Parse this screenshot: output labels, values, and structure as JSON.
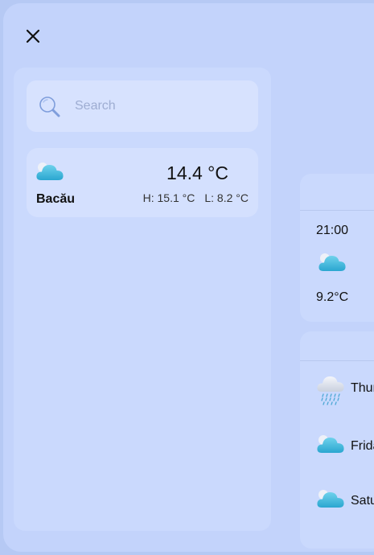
{
  "close": {
    "icon": "close-icon"
  },
  "search": {
    "placeholder": "Search",
    "value": "",
    "icon": "search-icon"
  },
  "city": {
    "name": "Bacău",
    "temperature": "14.4 °C",
    "high": "H: 15.1 °C",
    "low": "L: 8.2 °C",
    "icon": "partly-cloudy-icon"
  },
  "hourly": [
    {
      "time": "21:00",
      "temp": "9.2°C",
      "icon": "partly-cloudy-icon"
    }
  ],
  "daily": [
    {
      "day": "Thursday",
      "icon": "rain-icon"
    },
    {
      "day": "Friday",
      "icon": "partly-cloudy-icon"
    },
    {
      "day": "Saturday",
      "icon": "partly-cloudy-icon"
    }
  ],
  "colors": {
    "background": "#b6c9f4",
    "panel": "#cad9fd",
    "card": "#d4e0fe",
    "cloud": "#3fb8dc"
  }
}
